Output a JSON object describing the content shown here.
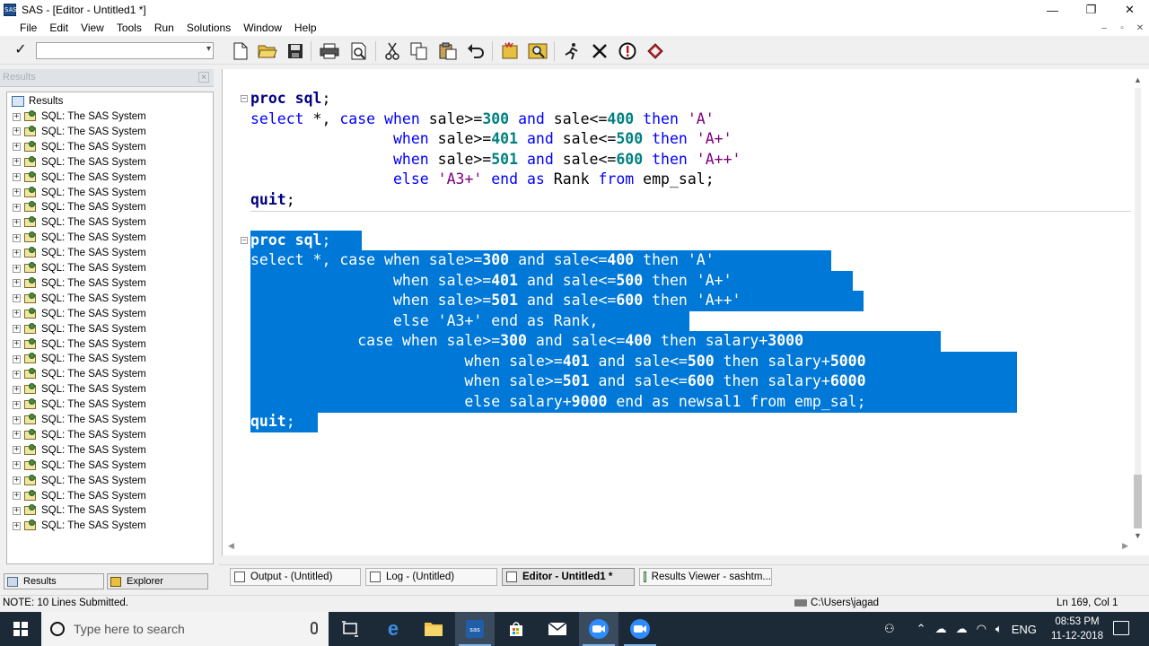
{
  "window": {
    "title": "SAS - [Editor - Untitled1 *]",
    "app_icon_text": "SAS",
    "controls": [
      "—",
      "❐",
      "✕"
    ]
  },
  "menu": {
    "items": [
      "File",
      "Edit",
      "View",
      "Tools",
      "Run",
      "Solutions",
      "Window",
      "Help"
    ],
    "mdi_controls": [
      "–",
      "▫",
      "✕"
    ]
  },
  "toolbar": {
    "check_glyph": "✓",
    "command_value": "",
    "dropdown_glyph": "▾"
  },
  "results_panel": {
    "header": "Results",
    "close_glyph": "×",
    "root_label": "Results",
    "items": [
      "SQL:  The SAS System",
      "SQL:  The SAS System",
      "SQL:  The SAS System",
      "SQL:  The SAS System",
      "SQL:  The SAS System",
      "SQL:  The SAS System",
      "SQL:  The SAS System",
      "SQL:  The SAS System",
      "SQL:  The SAS System",
      "SQL:  The SAS System",
      "SQL:  The SAS System",
      "SQL:  The SAS System",
      "SQL:  The SAS System",
      "SQL:  The SAS System",
      "SQL:  The SAS System",
      "SQL:  The SAS System",
      "SQL:  The SAS System",
      "SQL:  The SAS System",
      "SQL:  The SAS System",
      "SQL:  The SAS System",
      "SQL:  The SAS System",
      "SQL:  The SAS System",
      "SQL:  The SAS System",
      "SQL:  The SAS System",
      "SQL:  The SAS System",
      "SQL:  The SAS System",
      "SQL:  The SAS System",
      "SQL:  The SAS System"
    ],
    "tabs": [
      "Results",
      "Explorer"
    ]
  },
  "editor": {
    "lines": [
      [
        [
          "kw",
          "proc sql"
        ],
        [
          "plain",
          ";"
        ]
      ],
      [
        [
          "kw2",
          "select"
        ],
        [
          "plain",
          " *, "
        ],
        [
          "kw2",
          "case when"
        ],
        [
          "plain",
          " sale>="
        ],
        [
          "num",
          "300"
        ],
        [
          "plain",
          " "
        ],
        [
          "kw2",
          "and"
        ],
        [
          "plain",
          " sale<="
        ],
        [
          "num",
          "400"
        ],
        [
          "plain",
          " "
        ],
        [
          "kw2",
          "then"
        ],
        [
          "plain",
          " "
        ],
        [
          "str",
          "'A'"
        ]
      ],
      [
        [
          "plain",
          "                "
        ],
        [
          "kw2",
          "when"
        ],
        [
          "plain",
          " sale>="
        ],
        [
          "num",
          "401"
        ],
        [
          "plain",
          " "
        ],
        [
          "kw2",
          "and"
        ],
        [
          "plain",
          " sale<="
        ],
        [
          "num",
          "500"
        ],
        [
          "plain",
          " "
        ],
        [
          "kw2",
          "then"
        ],
        [
          "plain",
          " "
        ],
        [
          "str",
          "'A+'"
        ]
      ],
      [
        [
          "plain",
          "                "
        ],
        [
          "kw2",
          "when"
        ],
        [
          "plain",
          " sale>="
        ],
        [
          "num",
          "501"
        ],
        [
          "plain",
          " "
        ],
        [
          "kw2",
          "and"
        ],
        [
          "plain",
          " sale<="
        ],
        [
          "num",
          "600"
        ],
        [
          "plain",
          " "
        ],
        [
          "kw2",
          "then"
        ],
        [
          "plain",
          " "
        ],
        [
          "str",
          "'A++'"
        ]
      ],
      [
        [
          "plain",
          "                "
        ],
        [
          "kw2",
          "else"
        ],
        [
          "plain",
          " "
        ],
        [
          "str",
          "'A3+'"
        ],
        [
          "plain",
          " "
        ],
        [
          "kw2",
          "end as"
        ],
        [
          "plain",
          " Rank "
        ],
        [
          "kw2",
          "from"
        ],
        [
          "plain",
          " emp_sal;"
        ]
      ],
      [
        [
          "kw",
          "quit"
        ],
        [
          "plain",
          ";"
        ]
      ],
      [
        [
          "kw",
          "proc sql"
        ],
        [
          "plain",
          ";"
        ]
      ],
      [
        [
          "kw2",
          "select"
        ],
        [
          "plain",
          " *, "
        ],
        [
          "kw2",
          "case when"
        ],
        [
          "plain",
          " sale>="
        ],
        [
          "num",
          "300"
        ],
        [
          "plain",
          " "
        ],
        [
          "kw2",
          "and"
        ],
        [
          "plain",
          " sale<="
        ],
        [
          "num",
          "400"
        ],
        [
          "plain",
          " "
        ],
        [
          "kw2",
          "then"
        ],
        [
          "plain",
          " "
        ],
        [
          "str",
          "'A'"
        ]
      ],
      [
        [
          "plain",
          "                "
        ],
        [
          "kw2",
          "when"
        ],
        [
          "plain",
          " sale>="
        ],
        [
          "num",
          "401"
        ],
        [
          "plain",
          " "
        ],
        [
          "kw2",
          "and"
        ],
        [
          "plain",
          " sale<="
        ],
        [
          "num",
          "500"
        ],
        [
          "plain",
          " "
        ],
        [
          "kw2",
          "then"
        ],
        [
          "plain",
          " "
        ],
        [
          "str",
          "'A+'"
        ]
      ],
      [
        [
          "plain",
          "                "
        ],
        [
          "kw2",
          "when"
        ],
        [
          "plain",
          " sale>="
        ],
        [
          "num",
          "501"
        ],
        [
          "plain",
          " "
        ],
        [
          "kw2",
          "and"
        ],
        [
          "plain",
          " sale<="
        ],
        [
          "num",
          "600"
        ],
        [
          "plain",
          " "
        ],
        [
          "kw2",
          "then"
        ],
        [
          "plain",
          " "
        ],
        [
          "str",
          "'A++'"
        ]
      ],
      [
        [
          "plain",
          "                "
        ],
        [
          "kw2",
          "else"
        ],
        [
          "plain",
          " "
        ],
        [
          "str",
          "'A3+'"
        ],
        [
          "plain",
          " "
        ],
        [
          "kw2",
          "end as"
        ],
        [
          "plain",
          " Rank,"
        ]
      ],
      [
        [
          "plain",
          "            "
        ],
        [
          "kw2",
          "case when"
        ],
        [
          "plain",
          " sale>="
        ],
        [
          "num",
          "300"
        ],
        [
          "plain",
          " "
        ],
        [
          "kw2",
          "and"
        ],
        [
          "plain",
          " sale<="
        ],
        [
          "num",
          "400"
        ],
        [
          "plain",
          " "
        ],
        [
          "kw2",
          "then"
        ],
        [
          "plain",
          " salary+"
        ],
        [
          "num",
          "3000"
        ]
      ],
      [
        [
          "plain",
          "                        "
        ],
        [
          "kw2",
          "when"
        ],
        [
          "plain",
          " sale>="
        ],
        [
          "num",
          "401"
        ],
        [
          "plain",
          " "
        ],
        [
          "kw2",
          "and"
        ],
        [
          "plain",
          " sale<="
        ],
        [
          "num",
          "500"
        ],
        [
          "plain",
          " "
        ],
        [
          "kw2",
          "then"
        ],
        [
          "plain",
          " salary+"
        ],
        [
          "num",
          "5000"
        ]
      ],
      [
        [
          "plain",
          "                        "
        ],
        [
          "kw2",
          "when"
        ],
        [
          "plain",
          " sale>="
        ],
        [
          "num",
          "501"
        ],
        [
          "plain",
          " "
        ],
        [
          "kw2",
          "and"
        ],
        [
          "plain",
          " sale<="
        ],
        [
          "num",
          "600"
        ],
        [
          "plain",
          " "
        ],
        [
          "kw2",
          "then"
        ],
        [
          "plain",
          " salary+"
        ],
        [
          "num",
          "6000"
        ]
      ],
      [
        [
          "plain",
          "                        "
        ],
        [
          "kw2",
          "else"
        ],
        [
          "plain",
          " salary+"
        ],
        [
          "num",
          "9000"
        ],
        [
          "plain",
          " "
        ],
        [
          "kw2",
          "end as"
        ],
        [
          "plain",
          " newsal1 "
        ],
        [
          "kw2",
          "from"
        ],
        [
          "plain",
          " emp_sal;"
        ]
      ],
      [
        [
          "kw",
          "quit"
        ],
        [
          "plain",
          ";"
        ]
      ]
    ],
    "selected_from_line": 6,
    "fold_glyph": "⊟"
  },
  "window_tabs": [
    {
      "label": "Output - (Untitled)",
      "active": false
    },
    {
      "label": "Log - (Untitled)",
      "active": false
    },
    {
      "label": "Editor - Untitled1 *",
      "active": true
    },
    {
      "label": "Results Viewer - sashtm...",
      "active": false
    }
  ],
  "status": {
    "note": "NOTE: 10 Lines Submitted.",
    "path": "C:\\Users\\jagad",
    "position": "Ln 169, Col 1"
  },
  "taskbar": {
    "search_placeholder": "Type here to search",
    "language": "ENG",
    "time": "08:53 PM",
    "date": "11-12-2018"
  }
}
